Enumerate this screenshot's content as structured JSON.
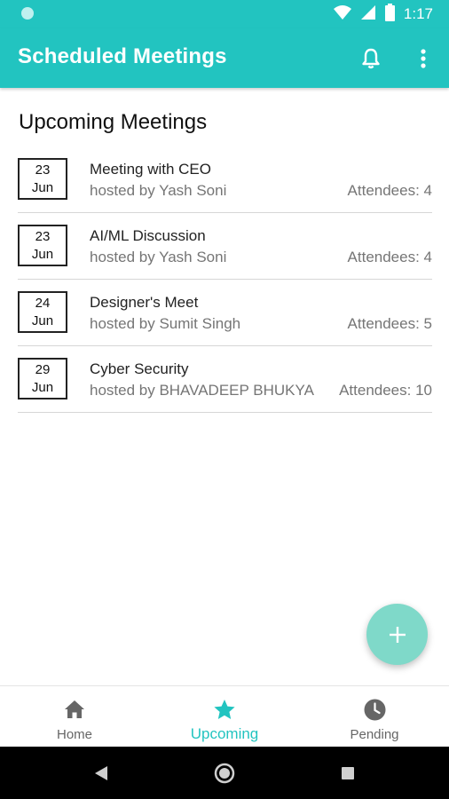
{
  "status_bar": {
    "time": "1:17"
  },
  "app_bar": {
    "title": "Scheduled Meetings",
    "actions": [
      "bell-icon",
      "more-vert-icon"
    ]
  },
  "section_title": "Upcoming Meetings",
  "meetings": [
    {
      "day": "23",
      "month": "Jun",
      "title": "Meeting with CEO",
      "host": "hosted by Yash Soni",
      "attendees": "Attendees: 4"
    },
    {
      "day": "23",
      "month": "Jun",
      "title": "AI/ML Discussion",
      "host": "hosted by Yash Soni",
      "attendees": "Attendees: 4"
    },
    {
      "day": "24",
      "month": "Jun",
      "title": "Designer's Meet",
      "host": "hosted by Sumit Singh",
      "attendees": "Attendees: 5"
    },
    {
      "day": "29",
      "month": "Jun",
      "title": "Cyber Security",
      "host": "hosted by BHAVADEEP BHUKYA",
      "attendees": "Attendees: 10"
    }
  ],
  "fab": {
    "icon": "plus-icon"
  },
  "bottom_nav": [
    {
      "label": "Home",
      "icon": "home-icon",
      "active": false
    },
    {
      "label": "Upcoming",
      "icon": "star-icon",
      "active": true
    },
    {
      "label": "Pending",
      "icon": "clock-icon",
      "active": false
    }
  ],
  "colors": {
    "primary": "#22c4c0",
    "fab": "#7fd9c9",
    "active_nav": "#22c4c0"
  }
}
